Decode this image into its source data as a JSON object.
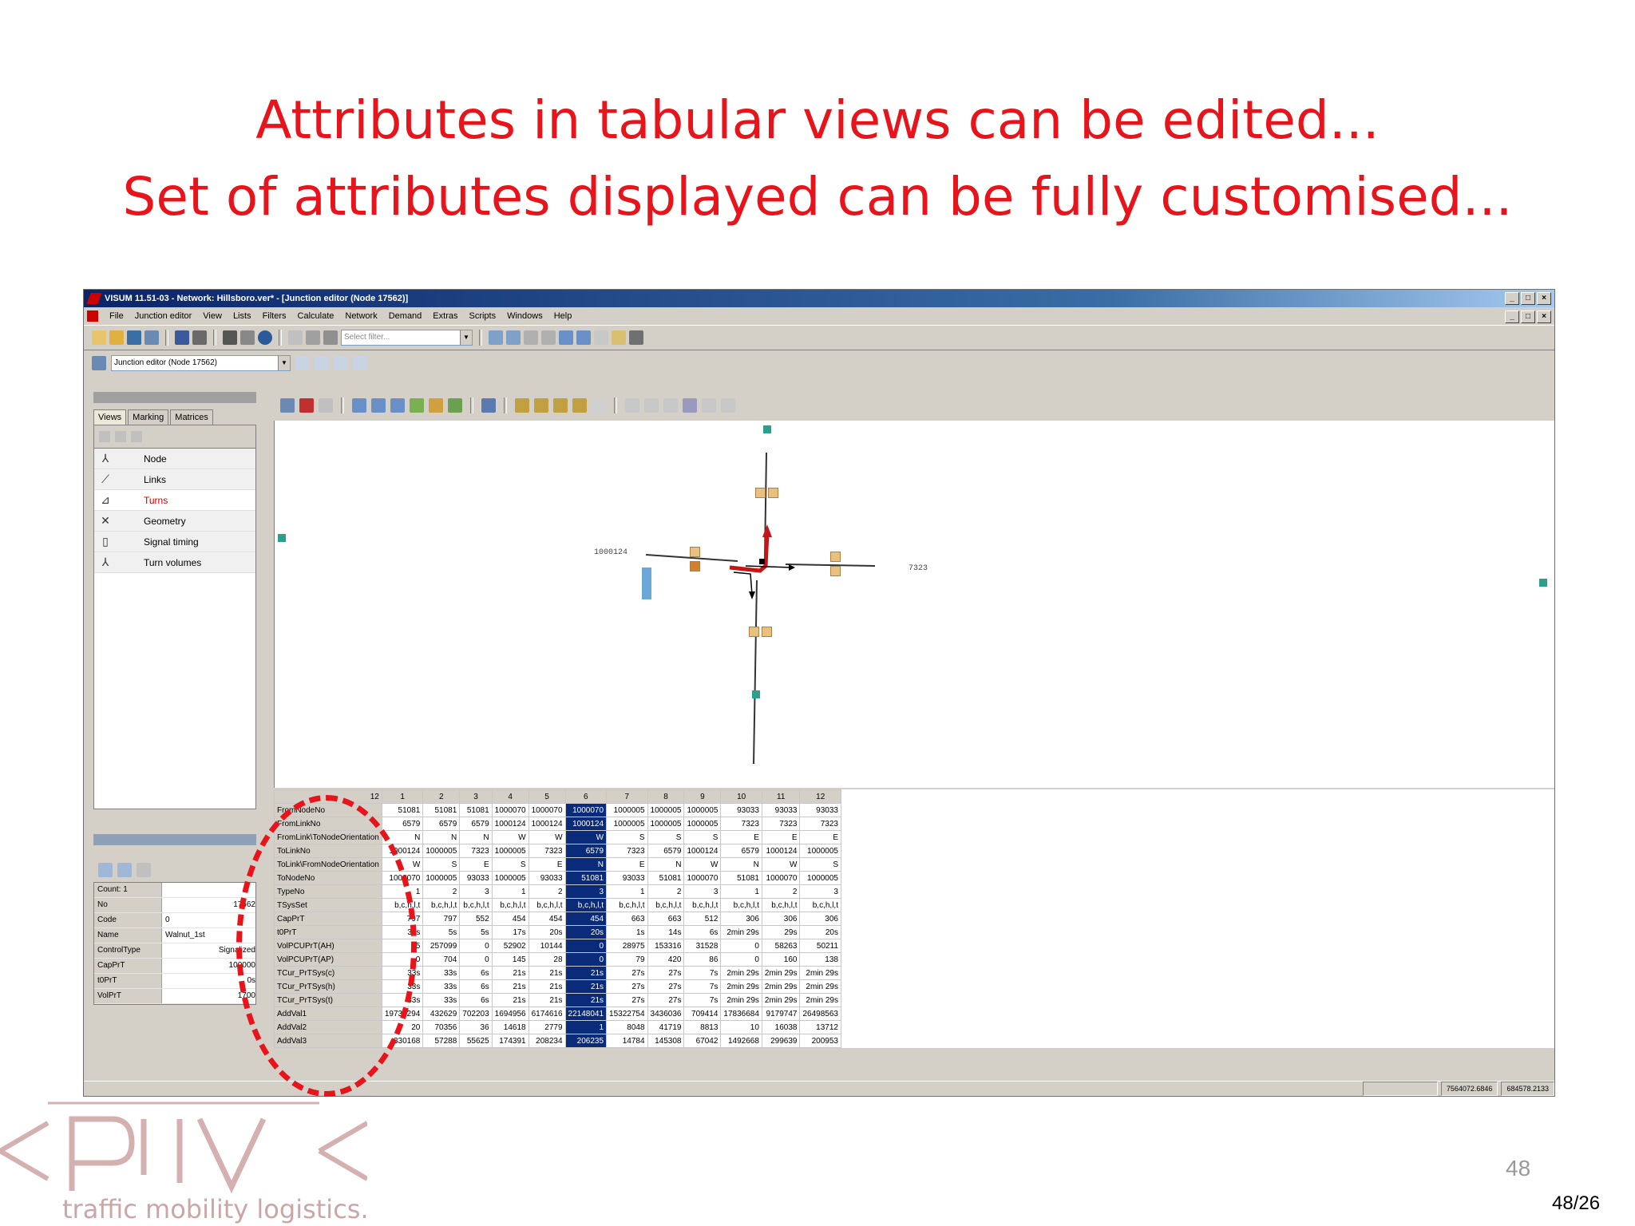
{
  "slide": {
    "title_line1": "Attributes in tabular views can be edited...",
    "title_line2": "Set of attributes displayed can be fully customised...",
    "page_number": "48",
    "page_fraction": "48/26",
    "logo_tagline": "traffic mobility logistics."
  },
  "window": {
    "title": "VISUM 11.51-03 - Network: Hillsboro.ver* - [Junction editor (Node 17562)]",
    "menu": [
      "File",
      "Junction editor",
      "View",
      "Lists",
      "Filters",
      "Calculate",
      "Network",
      "Demand",
      "Extras",
      "Scripts",
      "Windows",
      "Help"
    ],
    "toolbar_combo_placeholder": "Select filter...",
    "view_combo": "Junction editor (Node 17562)"
  },
  "nav": {
    "tabs": [
      "Views",
      "Marking",
      "Matrices"
    ],
    "items": [
      {
        "label": "Node"
      },
      {
        "label": "Links"
      },
      {
        "label": "Turns"
      },
      {
        "label": "Geometry"
      },
      {
        "label": "Signal timing"
      },
      {
        "label": "Turn volumes"
      }
    ]
  },
  "props": {
    "count": "Count: 1",
    "rows": [
      {
        "k": "No",
        "v": "17562"
      },
      {
        "k": "Code",
        "v": "0"
      },
      {
        "k": "Name",
        "v": "Walnut_1st"
      },
      {
        "k": "ControlType",
        "v": "Signalized"
      },
      {
        "k": "CapPrT",
        "v": "100000"
      },
      {
        "k": "t0PrT",
        "v": "0s"
      },
      {
        "k": "VolPrT",
        "v": "1700"
      }
    ]
  },
  "map": {
    "label_left": "1000124",
    "label_right": "7323"
  },
  "grid": {
    "corner": "12",
    "columns": [
      "1",
      "2",
      "3",
      "4",
      "5",
      "6",
      "7",
      "8",
      "9",
      "10",
      "11",
      "12"
    ],
    "highlight_col": 5,
    "rows": [
      {
        "name": "FromNodeNo",
        "vals": [
          "51081",
          "51081",
          "51081",
          "1000070",
          "1000070",
          "1000070",
          "1000005",
          "1000005",
          "1000005",
          "93033",
          "93033",
          "93033"
        ]
      },
      {
        "name": "FromLinkNo",
        "vals": [
          "6579",
          "6579",
          "6579",
          "1000124",
          "1000124",
          "1000124",
          "1000005",
          "1000005",
          "1000005",
          "7323",
          "7323",
          "7323"
        ]
      },
      {
        "name": "FromLink\\ToNodeOrientation",
        "vals": [
          "N",
          "N",
          "N",
          "W",
          "W",
          "W",
          "S",
          "S",
          "S",
          "E",
          "E",
          "E"
        ]
      },
      {
        "name": "ToLinkNo",
        "vals": [
          "1000124",
          "1000005",
          "7323",
          "1000005",
          "7323",
          "6579",
          "7323",
          "6579",
          "1000124",
          "6579",
          "1000124",
          "1000005"
        ]
      },
      {
        "name": "ToLink\\FromNodeOrientation",
        "vals": [
          "W",
          "S",
          "E",
          "S",
          "E",
          "N",
          "E",
          "N",
          "W",
          "N",
          "W",
          "S"
        ]
      },
      {
        "name": "ToNodeNo",
        "vals": [
          "1000070",
          "1000005",
          "93033",
          "1000005",
          "93033",
          "51081",
          "93033",
          "51081",
          "1000070",
          "51081",
          "1000070",
          "1000005"
        ]
      },
      {
        "name": "TypeNo",
        "vals": [
          "1",
          "2",
          "3",
          "1",
          "2",
          "3",
          "1",
          "2",
          "3",
          "1",
          "2",
          "3"
        ]
      },
      {
        "name": "TSysSet",
        "vals": [
          "b,c,h,l,t",
          "b,c,h,l,t",
          "b,c,h,l,t",
          "b,c,h,l,t",
          "b,c,h,l,t",
          "b,c,h,l,t",
          "b,c,h,l,t",
          "b,c,h,l,t",
          "b,c,h,l,t",
          "b,c,h,l,t",
          "b,c,h,l,t",
          "b,c,h,l,t"
        ]
      },
      {
        "name": "CapPrT",
        "vals": [
          "797",
          "797",
          "552",
          "454",
          "454",
          "454",
          "663",
          "663",
          "512",
          "306",
          "306",
          "306"
        ]
      },
      {
        "name": "t0PrT",
        "vals": [
          "33s",
          "5s",
          "5s",
          "17s",
          "20s",
          "20s",
          "1s",
          "14s",
          "6s",
          "2min 29s",
          "29s",
          "20s"
        ]
      },
      {
        "name": "VolPCUPrT(AH)",
        "vals": [
          "75",
          "257099",
          "0",
          "52902",
          "10144",
          "0",
          "28975",
          "153316",
          "31528",
          "0",
          "58263",
          "50211"
        ]
      },
      {
        "name": "VolPCUPrT(AP)",
        "vals": [
          "0",
          "704",
          "0",
          "145",
          "28",
          "0",
          "79",
          "420",
          "86",
          "0",
          "160",
          "138"
        ]
      },
      {
        "name": "TCur_PrTSys(c)",
        "vals": [
          "33s",
          "33s",
          "6s",
          "21s",
          "21s",
          "21s",
          "27s",
          "27s",
          "7s",
          "2min 29s",
          "2min 29s",
          "2min 29s"
        ]
      },
      {
        "name": "TCur_PrTSys(h)",
        "vals": [
          "33s",
          "33s",
          "6s",
          "21s",
          "21s",
          "21s",
          "27s",
          "27s",
          "7s",
          "2min 29s",
          "2min 29s",
          "2min 29s"
        ]
      },
      {
        "name": "TCur_PrTSys(t)",
        "vals": [
          "33s",
          "33s",
          "6s",
          "21s",
          "21s",
          "21s",
          "27s",
          "27s",
          "7s",
          "2min 29s",
          "2min 29s",
          "2min 29s"
        ]
      },
      {
        "name": "AddVal1",
        "vals": [
          "19736294",
          "432629",
          "702203",
          "1694956",
          "6174616",
          "22148041",
          "15322754",
          "3436036",
          "709414",
          "17836684",
          "9179747",
          "26498563"
        ]
      },
      {
        "name": "AddVal2",
        "vals": [
          "20",
          "70356",
          "36",
          "14618",
          "2779",
          "1",
          "8048",
          "41719",
          "8813",
          "10",
          "16038",
          "13712"
        ]
      },
      {
        "name": "AddVal3",
        "vals": [
          "330168",
          "57288",
          "55625",
          "174391",
          "208234",
          "206235",
          "14784",
          "145308",
          "67042",
          "1492668",
          "299639",
          "200953"
        ]
      }
    ]
  },
  "status": {
    "x": "7564072.6846",
    "y": "684578.2133"
  }
}
